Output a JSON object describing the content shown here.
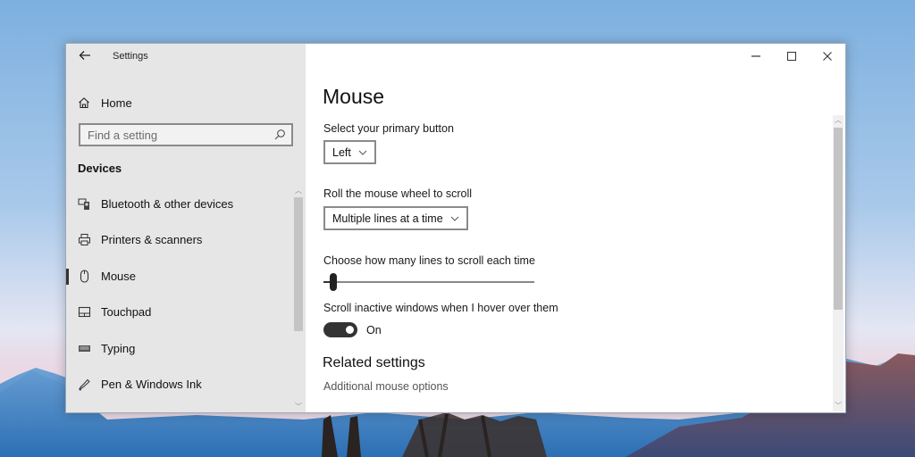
{
  "window": {
    "app_title": "Settings",
    "back_icon": "arrow-left-icon",
    "caption": {
      "minimize_icon": "minimize-icon",
      "maximize_icon": "maximize-icon",
      "close_icon": "close-icon",
      "minimize_glyph": "—",
      "maximize_glyph": "☐",
      "close_glyph": "✕"
    }
  },
  "sidebar": {
    "home_label": "Home",
    "search_placeholder": "Find a setting",
    "search_value": "",
    "section_title": "Devices",
    "items": [
      {
        "label": "Bluetooth & other devices",
        "icon": "bluetooth-devices-icon",
        "active": false
      },
      {
        "label": "Printers & scanners",
        "icon": "printer-icon",
        "active": false
      },
      {
        "label": "Mouse",
        "icon": "mouse-icon",
        "active": true
      },
      {
        "label": "Touchpad",
        "icon": "touchpad-icon",
        "active": false
      },
      {
        "label": "Typing",
        "icon": "keyboard-icon",
        "active": false
      },
      {
        "label": "Pen & Windows Ink",
        "icon": "pen-icon",
        "active": false
      }
    ]
  },
  "main": {
    "title": "Mouse",
    "primary_button": {
      "label": "Select your primary button",
      "value": "Left"
    },
    "wheel_scroll": {
      "label": "Roll the mouse wheel to scroll",
      "value": "Multiple lines at a time"
    },
    "lines_to_scroll": {
      "label": "Choose how many lines to scroll each time",
      "value_fraction": 0.03
    },
    "inactive_scroll": {
      "label": "Scroll inactive windows when I hover over them",
      "state": "On",
      "enabled": true
    },
    "related": {
      "title": "Related settings",
      "links": [
        "Additional mouse options"
      ]
    }
  }
}
